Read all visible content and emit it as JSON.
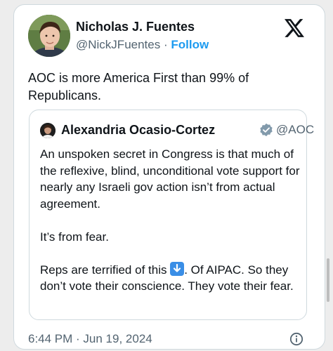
{
  "tweet": {
    "author_name": "Nicholas J. Fuentes",
    "author_handle": "@NickJFuentes",
    "separator": " · ",
    "follow_label": "Follow",
    "text": "AOC is more America First than 99% of Republicans.",
    "timestamp": "6:44 PM · Jun 19, 2024"
  },
  "quote": {
    "author_name": "Alexandria Ocasio-Cortez",
    "author_handle": "@AOC",
    "paragraph1": "An unspoken secret in Congress is that much of the reflexive, blind,  unconditional vote support for nearly any Israeli gov action isn’t from actual agreement.",
    "paragraph2": "It’s from fear.",
    "paragraph3_before_emoji": "Reps are terrified of this ",
    "paragraph3_after_emoji": ". Of AIPAC. So they don’t vote their conscience. They vote their fear."
  },
  "icons": {
    "platform_logo": "x-logo-icon",
    "verified": "verified-badge-icon",
    "emoji": "down-arrow-emoji-icon",
    "info": "info-icon"
  },
  "colors": {
    "link": "#1d9bf0",
    "secondary_text": "#536471",
    "primary_text": "#0f1419",
    "verified_badge": "#829aab"
  }
}
